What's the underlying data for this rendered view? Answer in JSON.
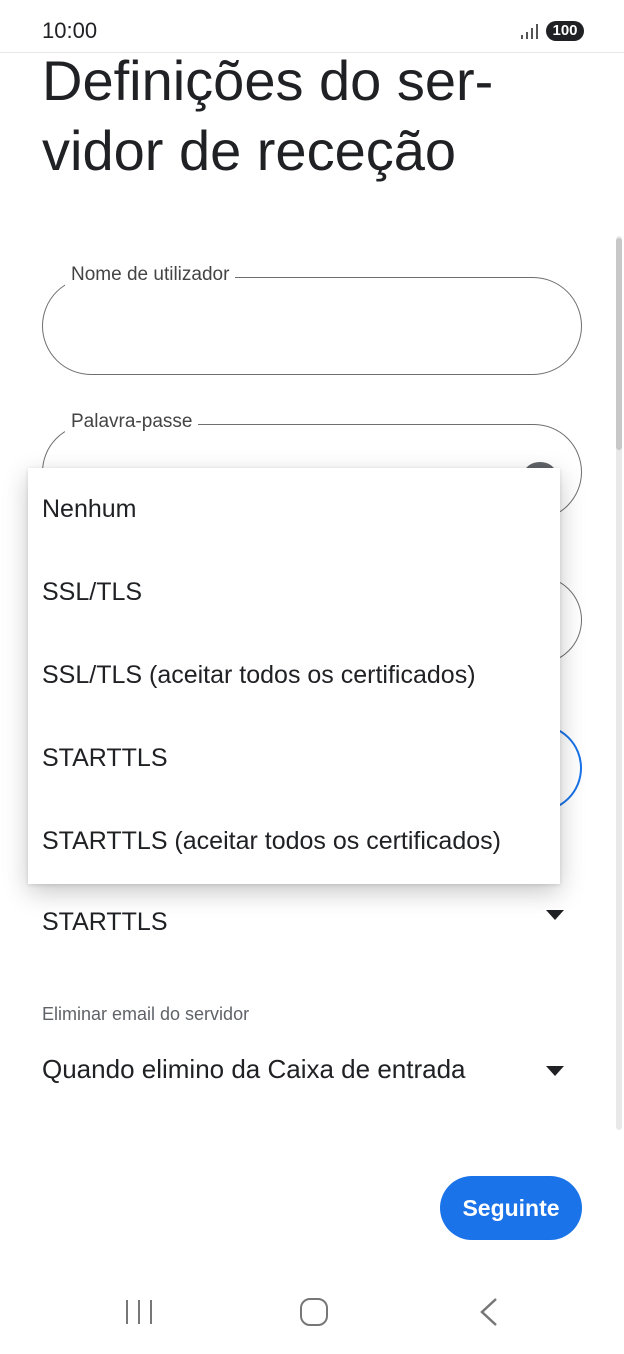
{
  "status_bar": {
    "time": "10:00",
    "battery": "100",
    "signal_icon": "signal-bars-icon"
  },
  "page": {
    "title": "Definições do ser-vidor de receção"
  },
  "form": {
    "username": {
      "label": "Nome de utilizador",
      "value": ""
    },
    "password": {
      "label": "Palavra-passe",
      "value": "",
      "toggle_icon": "eye-icon"
    },
    "security": {
      "selected": "STARTTLS"
    },
    "delete_email": {
      "label": "Eliminar email do servidor",
      "selected": "Quando elimino da Caixa de entrada"
    }
  },
  "security_menu": {
    "options": [
      "Nenhum",
      "SSL/TLS",
      "SSL/TLS (aceitar todos os certificados)",
      "STARTTLS",
      "STARTTLS (aceitar todos os certificados)"
    ]
  },
  "actions": {
    "next_label": "Seguinte"
  },
  "navigation": {
    "icons": [
      "recents-icon",
      "home-icon",
      "back-icon"
    ]
  },
  "colors": {
    "accent": "#1a73e8",
    "text": "#202124",
    "secondary_text": "#5f6368"
  }
}
